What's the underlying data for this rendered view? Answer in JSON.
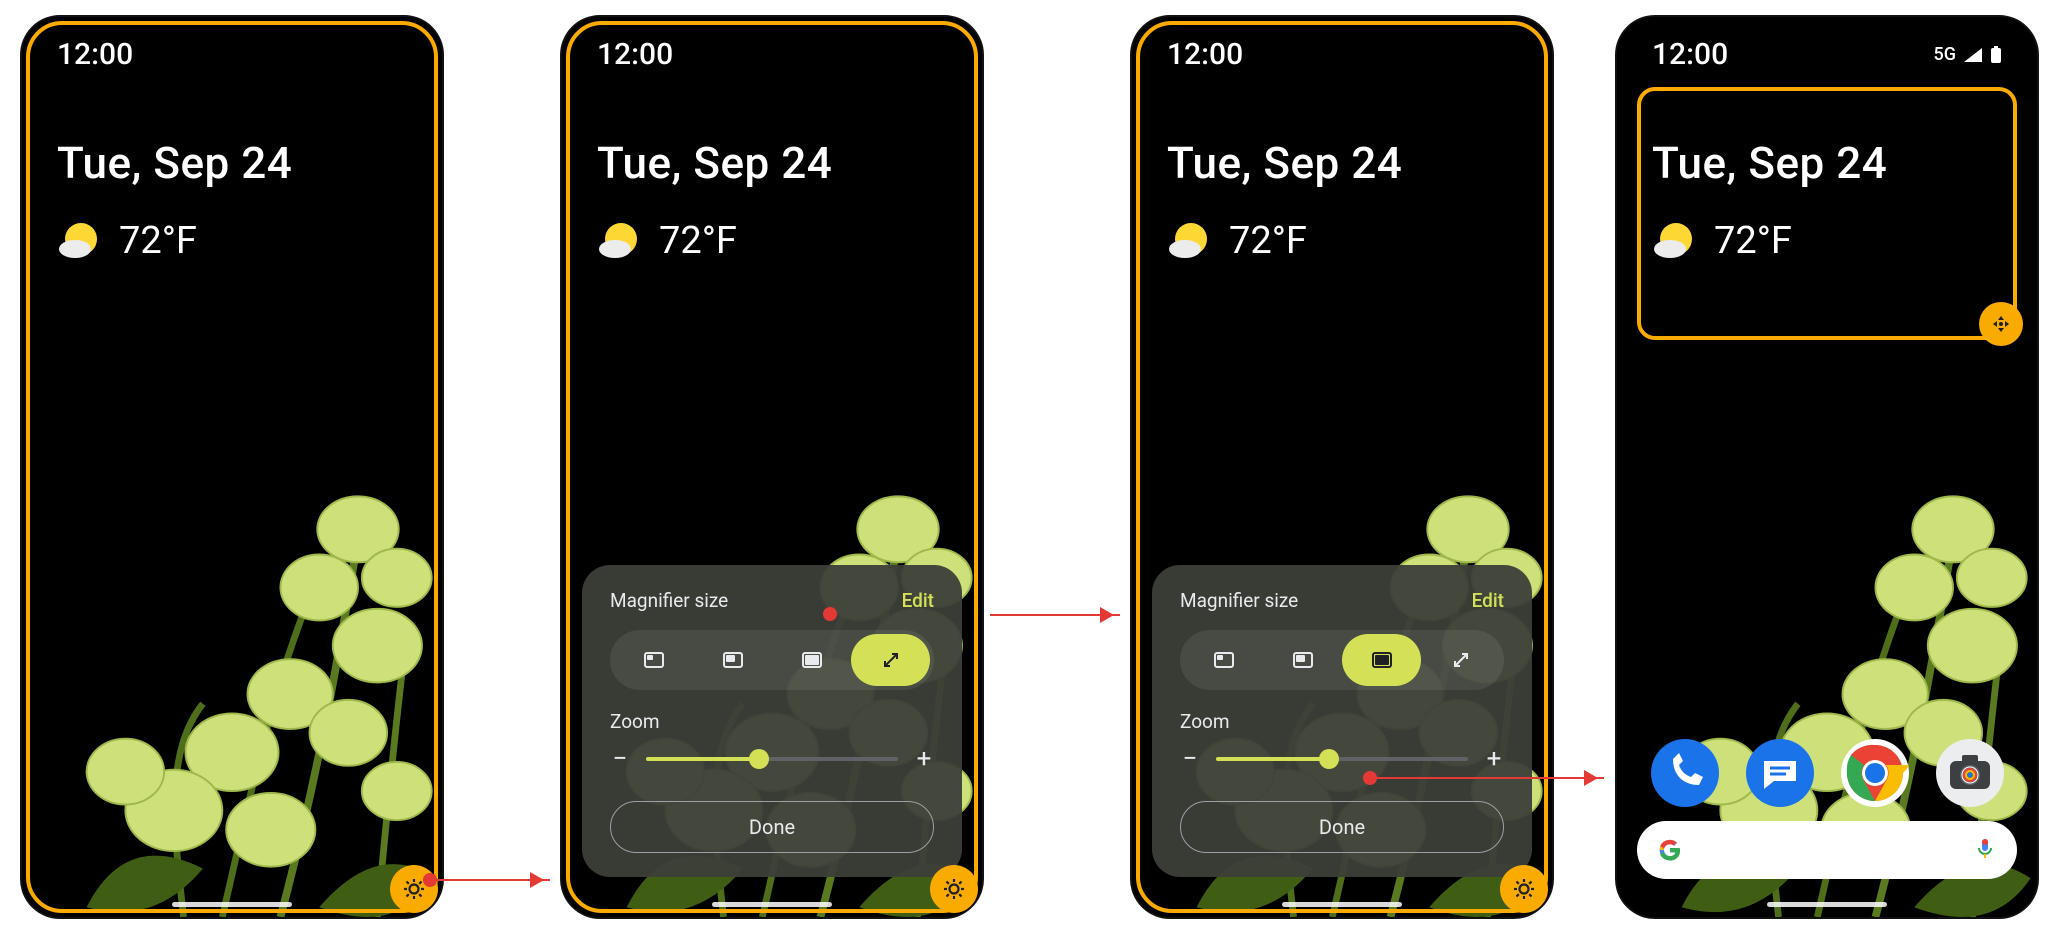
{
  "status": {
    "time": "12:00",
    "network": "5G"
  },
  "date": "Tue, Sep 24",
  "temp": "72°F",
  "panel": {
    "title": "Magnifier size",
    "edit": "Edit",
    "zoom": "Zoom",
    "done": "Done",
    "zoom_value": 0.45
  },
  "colors": {
    "accent": "#d4e157",
    "highlight": "#f9ab00"
  },
  "screens": {
    "s2": {
      "selected": 3
    },
    "s3": {
      "selected": 2
    }
  }
}
